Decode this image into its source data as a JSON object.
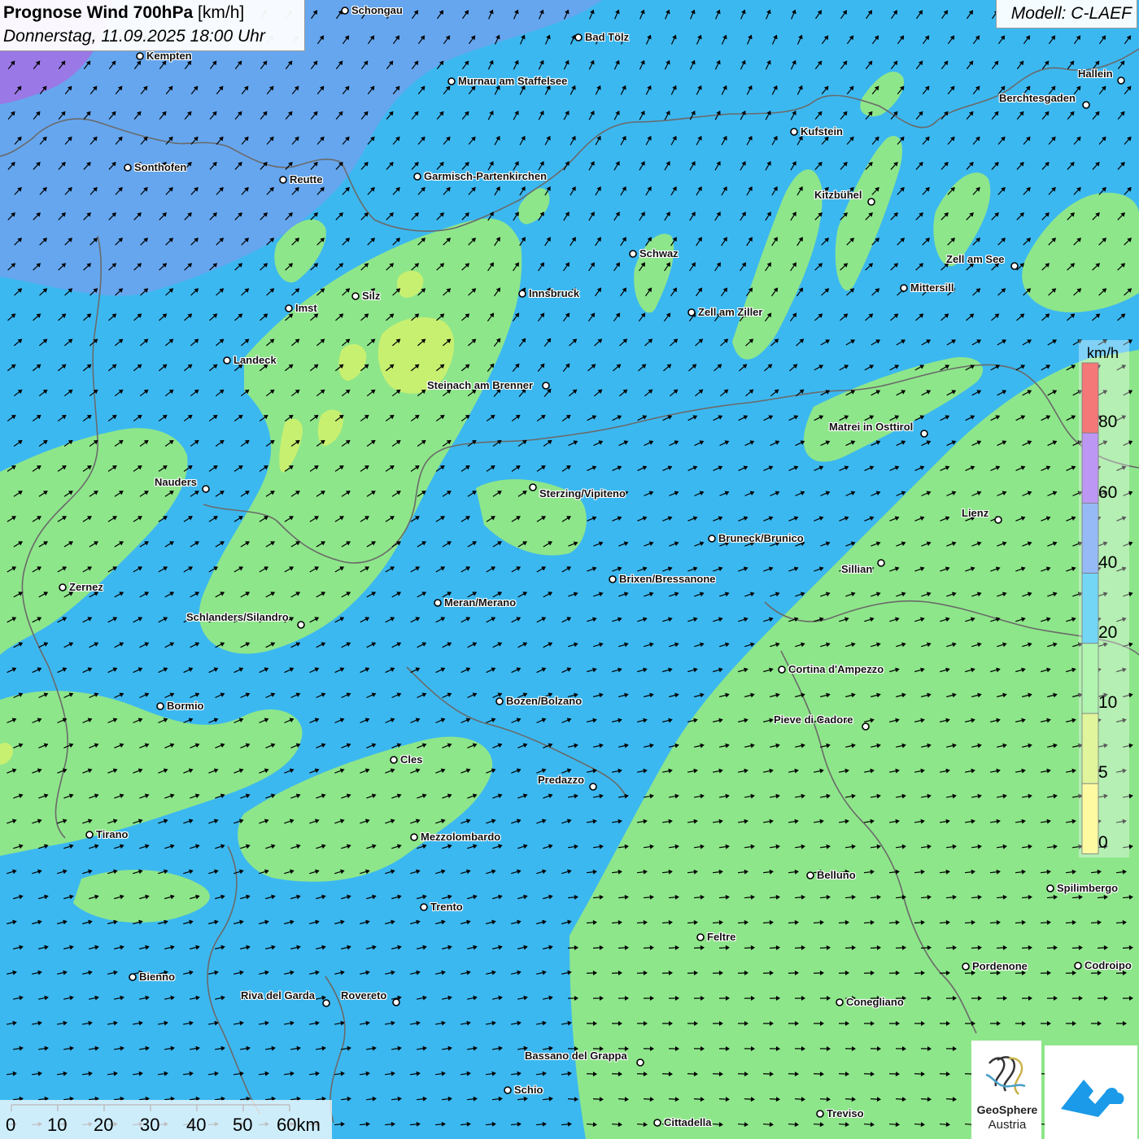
{
  "title": {
    "main": "Prognose Wind 700hPa",
    "unit": " [km/h]",
    "date": "Donnerstag, 11.09.2025 18:00 Uhr"
  },
  "model": "Modell: C-LAEF",
  "colors": {
    "base": "#3cb8f0",
    "green": "#8ee68a",
    "light_green": "#c8f070",
    "blue_mid": "#66a6ee",
    "purple": "#9a78e6",
    "red": "#f03030",
    "yellow": "#fff870"
  },
  "legend": {
    "unit": "km/h",
    "ticks": [
      "80",
      "60",
      "40",
      "20",
      "10",
      "5",
      "0"
    ],
    "bands": [
      {
        "from": 80,
        "color": "#f03030"
      },
      {
        "from": 60,
        "color": "#9a60ee"
      },
      {
        "from": 40,
        "color": "#5f96f0"
      },
      {
        "from": 20,
        "color": "#28c0f0"
      },
      {
        "from": 10,
        "color": "#88f088"
      },
      {
        "from": 5,
        "color": "#d0f068"
      },
      {
        "from": 0,
        "color": "#fcf870"
      }
    ]
  },
  "scalebar": {
    "labels": [
      "0",
      "10",
      "20",
      "30",
      "40",
      "50",
      "60km"
    ]
  },
  "logos": {
    "geosphere_line1": "GeoSphere",
    "geosphere_line2": "Austria"
  },
  "cities": [
    {
      "name": "Schongau",
      "dot": [
        424,
        13
      ],
      "label": [
        432,
        13
      ]
    },
    {
      "name": "Bad Tölz",
      "dot": [
        711,
        46
      ],
      "label": [
        719,
        46
      ]
    },
    {
      "name": "Kempten",
      "dot": [
        172,
        69
      ],
      "label": [
        180,
        69
      ]
    },
    {
      "name": "Murnau am Staffelsee",
      "dot": [
        555,
        100
      ],
      "label": [
        563,
        100
      ]
    },
    {
      "name": "Hallein",
      "dot": [
        1378,
        99
      ],
      "label": [
        1325,
        91
      ]
    },
    {
      "name": "Berchtesgaden",
      "dot": [
        1335,
        129
      ],
      "label": [
        1228,
        121
      ]
    },
    {
      "name": "Kufstein",
      "dot": [
        976,
        162
      ],
      "label": [
        984,
        162
      ]
    },
    {
      "name": "Sonthofen",
      "dot": [
        157,
        206
      ],
      "label": [
        165,
        206
      ]
    },
    {
      "name": "Reutte",
      "dot": [
        348,
        221
      ],
      "label": [
        356,
        221
      ]
    },
    {
      "name": "Garmisch-Partenkirchen",
      "dot": [
        513,
        217
      ],
      "label": [
        521,
        217
      ]
    },
    {
      "name": "Kitzbühel",
      "dot": [
        1071,
        248
      ],
      "label": [
        1001,
        240
      ]
    },
    {
      "name": "Schwaz",
      "dot": [
        778,
        312
      ],
      "label": [
        786,
        312
      ]
    },
    {
      "name": "Zell am See",
      "dot": [
        1247,
        327
      ],
      "label": [
        1163,
        319
      ]
    },
    {
      "name": "Mittersill",
      "dot": [
        1111,
        354
      ],
      "label": [
        1119,
        354
      ]
    },
    {
      "name": "Silz",
      "dot": [
        437,
        364
      ],
      "label": [
        445,
        364
      ]
    },
    {
      "name": "Innsbruck",
      "dot": [
        642,
        361
      ],
      "label": [
        650,
        361
      ]
    },
    {
      "name": "Imst",
      "dot": [
        355,
        379
      ],
      "label": [
        363,
        379
      ]
    },
    {
      "name": "Zell am Ziller",
      "dot": [
        850,
        384
      ],
      "label": [
        858,
        384
      ]
    },
    {
      "name": "Landeck",
      "dot": [
        279,
        443
      ],
      "label": [
        287,
        443
      ]
    },
    {
      "name": "Steinach am Brenner",
      "dot": [
        671,
        474
      ],
      "label": [
        525,
        474
      ]
    },
    {
      "name": "Matrei in Osttirol",
      "dot": [
        1136,
        533
      ],
      "label": [
        1019,
        525
      ]
    },
    {
      "name": "Nauders",
      "dot": [
        253,
        601
      ],
      "label": [
        190,
        593
      ]
    },
    {
      "name": "Sterzing/Vipiteno",
      "dot": [
        655,
        599
      ],
      "label": [
        663,
        607
      ]
    },
    {
      "name": "Lienz",
      "dot": [
        1227,
        639
      ],
      "label": [
        1182,
        631
      ]
    },
    {
      "name": "Bruneck/Brunico",
      "dot": [
        875,
        662
      ],
      "label": [
        883,
        662
      ]
    },
    {
      "name": "Sillian",
      "dot": [
        1083,
        692
      ],
      "label": [
        1034,
        700
      ]
    },
    {
      "name": "Brixen/Bressanone",
      "dot": [
        753,
        712
      ],
      "label": [
        761,
        712
      ]
    },
    {
      "name": "Zernez",
      "dot": [
        77,
        722
      ],
      "label": [
        85,
        722
      ]
    },
    {
      "name": "Meran/Merano",
      "dot": [
        538,
        741
      ],
      "label": [
        546,
        741
      ]
    },
    {
      "name": "Schlanders/Silandro",
      "dot": [
        370,
        768
      ],
      "label": [
        229,
        759
      ]
    },
    {
      "name": "Cortina d'Ampezzo",
      "dot": [
        961,
        823
      ],
      "label": [
        969,
        823
      ]
    },
    {
      "name": "Bozen/Bolzano",
      "dot": [
        614,
        862
      ],
      "label": [
        622,
        862
      ]
    },
    {
      "name": "Bormio",
      "dot": [
        197,
        868
      ],
      "label": [
        205,
        868
      ]
    },
    {
      "name": "Pieve di Cadore",
      "dot": [
        1064,
        893
      ],
      "label": [
        951,
        885
      ]
    },
    {
      "name": "Cles",
      "dot": [
        484,
        934
      ],
      "label": [
        492,
        934
      ]
    },
    {
      "name": "Predazzo",
      "dot": [
        729,
        967
      ],
      "label": [
        661,
        959
      ]
    },
    {
      "name": "Tirano",
      "dot": [
        110,
        1026
      ],
      "label": [
        118,
        1026
      ]
    },
    {
      "name": "Mezzolombardo",
      "dot": [
        509,
        1029
      ],
      "label": [
        517,
        1029
      ]
    },
    {
      "name": "Belluno",
      "dot": [
        996,
        1076
      ],
      "label": [
        1004,
        1076
      ]
    },
    {
      "name": "Spilimbergo",
      "dot": [
        1291,
        1092
      ],
      "label": [
        1299,
        1092
      ]
    },
    {
      "name": "Trento",
      "dot": [
        521,
        1115
      ],
      "label": [
        529,
        1115
      ]
    },
    {
      "name": "Feltre",
      "dot": [
        861,
        1152
      ],
      "label": [
        869,
        1152
      ]
    },
    {
      "name": "Pordenone",
      "dot": [
        1187,
        1188
      ],
      "label": [
        1195,
        1188
      ]
    },
    {
      "name": "Codroipo",
      "dot": [
        1325,
        1187
      ],
      "label": [
        1333,
        1187
      ]
    },
    {
      "name": "Bienno",
      "dot": [
        163,
        1201
      ],
      "label": [
        171,
        1201
      ]
    },
    {
      "name": "Riva del Garda",
      "dot": [
        401,
        1233
      ],
      "label": [
        296,
        1224
      ]
    },
    {
      "name": "Rovereto",
      "dot": [
        487,
        1232
      ],
      "label": [
        419,
        1224
      ]
    },
    {
      "name": "Conegliano",
      "dot": [
        1032,
        1232
      ],
      "label": [
        1040,
        1232
      ]
    },
    {
      "name": "Bassano del Grappa",
      "dot": [
        787,
        1306
      ],
      "label": [
        645,
        1298
      ]
    },
    {
      "name": "Schio",
      "dot": [
        624,
        1340
      ],
      "label": [
        632,
        1340
      ]
    },
    {
      "name": "Treviso",
      "dot": [
        1008,
        1369
      ],
      "label": [
        1016,
        1369
      ]
    },
    {
      "name": "Cittadella",
      "dot": [
        808,
        1380
      ],
      "label": [
        816,
        1380
      ]
    }
  ]
}
